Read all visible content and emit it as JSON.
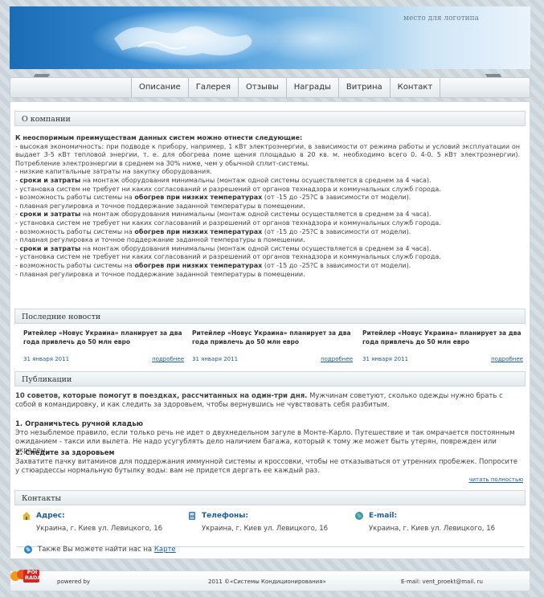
{
  "header": {
    "logo_placeholder": "место для логотипа"
  },
  "nav": {
    "items": [
      "Описание",
      "Галерея",
      "Отзывы",
      "Награды",
      "Витрина",
      "Контакт"
    ]
  },
  "about": {
    "title": "О компании",
    "intro": "К неоспоримым преимуществам данных систем можно отнести следующие:",
    "p1": "- высокая экономичность: при подводе к прибору, например, 1 кВт электроэнергии, в зависимости от режима работы и условий эксплуатации он выдает 3-5 кВт тепловой энергии, т. е. для обогрева поме щения площадью в 20 кв. м. необходимо всего 0. 4-0. 5 кВт электроэнергии). Потребление электроэнергии в среднем на 30% ниже, чем у обычной сплит-системы.",
    "p2": "- низкие капитальные затраты на закупку оборудования.",
    "bold_terms": "сроки и затраты",
    "l_terms": "на монтаж оборудования минимальны (монтаж одной системы осуществляется в среднем за 4 часа).",
    "l_install": "- установка систем не требует ни каких согласований и разрешений от органов технадзора и коммунальных служб города.",
    "l_heat_a": "- возможность работы системы на ",
    "bold_heat": "обогрев при низких температурах",
    "l_heat_b": " (от -15 до -25?С в зависимости от модели).",
    "l_reg": "- плавная регулировка и точное поддержание заданной температуры в помещении."
  },
  "news": {
    "title": "Последние новости",
    "items": [
      {
        "text": "Ритейлер «Новус Украина» планирует за два года привлечь до 50 млн евро",
        "date": "31 января 2011",
        "more": "подробнее"
      },
      {
        "text": "Ритейлер «Новус Украина» планирует за два года привлечь до 50 млн евро",
        "date": "31 января 2011",
        "more": "подробнее"
      },
      {
        "text": "Ритейлер «Новус Украина» планирует за два года привлечь до 50 млн евро",
        "date": "31 января 2011",
        "more": "подробнее"
      }
    ]
  },
  "publications": {
    "title": "Публикации",
    "lead_bold": "10 советов, которые помогут в поездках, рассчитанных на один-три дня.",
    "lead_text": " Мужчинам советуют, сколько одежды нужно брать с собой в командировку, и как следить за здоровьем, чтобы вернувшись не чувствовать себя разбитым.",
    "h1": "1.  Ограничьтесь ручной кладью",
    "t1": "Это незыблемое правило, если только речь не идет о двухнедельном загуле в Монте-Карло. Путешествие и так омрачается постоянным ожиданием - такси или вылета. Не надо усугублять дело наличием багажа, который к тому же может быть утерян, поврежден или украден.",
    "h2": "2.  Следите за здоровьем",
    "t2": "Захватите пачку витаминов для поддержания иммунной системы и кроссовки, чтобы не отказываться от утренних пробежек. Попросите у стюардессы нормальную бутылку воды: вам не придется дергать ее каждый раз.",
    "read_more": "читать полностью"
  },
  "contacts": {
    "title": "Контакты",
    "items": [
      {
        "label": "Адрес:",
        "value": "Украина, г. Киев ул. Левицкого, 16"
      },
      {
        "label": "Телефоны:",
        "value": "Украина, г. Киев ул. Левицкого, 16"
      },
      {
        "label": "E-mail:",
        "value": "Украина, г. Киев ул. Левицкого, 16"
      }
    ],
    "map_text": "Также Вы можете найти нас на ",
    "map_link": "Карте"
  },
  "footer": {
    "logo_text": "POI RADAR",
    "powered": "powered by",
    "copyright": "2011 ©«Системы Кондиционирования»",
    "email_label": "E-mail:",
    "email": "vent_proekt@mail. ru"
  },
  "colors": {
    "link": "#1c5e9c",
    "header_blue": "#1a6cb5"
  }
}
